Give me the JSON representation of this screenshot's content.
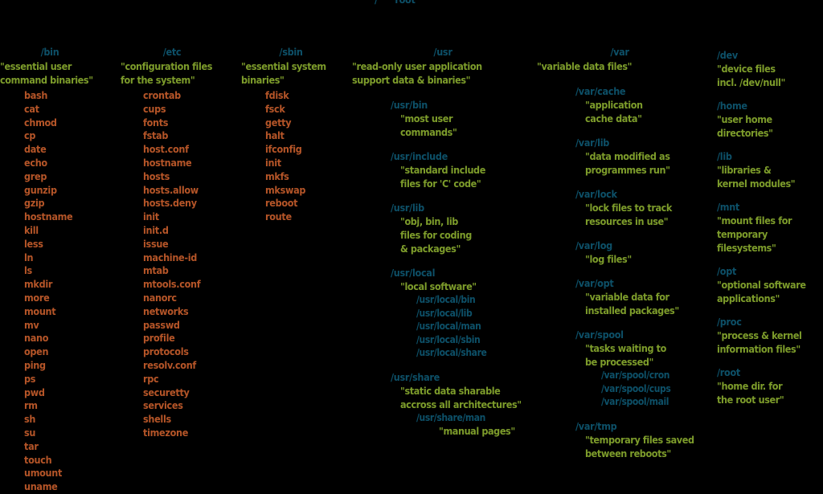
{
  "diagram": {
    "title_root": {
      "path": "/",
      "label": "\"root\""
    },
    "colors": {
      "background": "#000000",
      "directory": "#0d5068",
      "description": "#7d9c2b",
      "file": "#b55528"
    },
    "columns": [
      {
        "id": "bin",
        "name": "/bin",
        "description": [
          "\"essential user",
          "command binaries\""
        ],
        "files": [
          "bash",
          "cat",
          "chmod",
          "cp",
          "date",
          "echo",
          "grep",
          "gunzip",
          "gzip",
          "hostname",
          "kill",
          "less",
          "ln",
          "ls",
          "mkdir",
          "more",
          "mount",
          "mv",
          "nano",
          "open",
          "ping",
          "ps",
          "pwd",
          "rm",
          "sh",
          "su",
          "tar",
          "touch",
          "umount",
          "uname"
        ]
      },
      {
        "id": "etc",
        "name": "/etc",
        "description": [
          "\"configuration files",
          "for the system\""
        ],
        "files": [
          "crontab",
          "cups",
          "fonts",
          "fstab",
          "host.conf",
          "hostname",
          "hosts",
          "hosts.allow",
          "hosts.deny",
          "init",
          "init.d",
          "issue",
          "machine-id",
          "mtab",
          "mtools.conf",
          "nanorc",
          "networks",
          "passwd",
          "profile",
          "protocols",
          "resolv.conf",
          "rpc",
          "securetty",
          "services",
          "shells",
          "timezone"
        ]
      },
      {
        "id": "sbin",
        "name": "/sbin",
        "description": [
          "\"essential system",
          "binaries\""
        ],
        "files": [
          "fdisk",
          "fsck",
          "getty",
          "halt",
          "ifconfig",
          "init",
          "mkfs",
          "mkswap",
          "reboot",
          "route"
        ]
      },
      {
        "id": "usr",
        "name": "/usr",
        "description": [
          "\"read-only user application",
          "support data & binaries\""
        ],
        "groups": [
          {
            "name": "/usr/bin",
            "description": [
              "\"most user",
              "commands\""
            ],
            "children": []
          },
          {
            "name": "/usr/include",
            "description": [
              "\"standard include",
              "files for 'C' code\""
            ],
            "children": []
          },
          {
            "name": "/usr/lib",
            "description": [
              "\"obj, bin, lib",
              "files for coding",
              "& packages\""
            ],
            "children": []
          },
          {
            "name": "/usr/local",
            "description": [
              "\"local software\""
            ],
            "children": [
              "/usr/local/bin",
              "/usr/local/lib",
              "/usr/local/man",
              "/usr/local/sbin",
              "/usr/local/share"
            ]
          },
          {
            "name": "/usr/share",
            "description": [
              "\"static data sharable",
              "accross all architectures\""
            ],
            "children": [
              "/usr/share/man"
            ],
            "child_description": [
              "\"manual pages\""
            ]
          }
        ]
      },
      {
        "id": "var",
        "name": "/var",
        "description": [
          "\"variable data files\""
        ],
        "groups": [
          {
            "name": "/var/cache",
            "description": [
              "\"application",
              "cache data\""
            ],
            "children": []
          },
          {
            "name": "/var/lib",
            "description": [
              "\"data modified as",
              "programmes run\""
            ],
            "children": []
          },
          {
            "name": "/var/lock",
            "description": [
              "\"lock files to track",
              "resources in use\""
            ],
            "children": []
          },
          {
            "name": "/var/log",
            "description": [
              "\"log files\""
            ],
            "children": []
          },
          {
            "name": "/var/opt",
            "description": [
              "\"variable data for",
              "installed packages\""
            ],
            "children": []
          },
          {
            "name": "/var/spool",
            "description": [
              "\"tasks waiting to",
              "be processed\""
            ],
            "children": [
              "/var/spool/cron",
              "/var/spool/cups",
              "/var/spool/mail"
            ]
          },
          {
            "name": "/var/tmp",
            "description": [
              "\"temporary files saved",
              "between reboots\""
            ],
            "children": []
          }
        ]
      },
      {
        "id": "misc",
        "name": "",
        "description": [],
        "groups": [
          {
            "name": "/dev",
            "description": [
              "\"device files",
              "incl. /dev/null\""
            ],
            "children": []
          },
          {
            "name": "/home",
            "description": [
              "\"user home",
              "directories\""
            ],
            "children": []
          },
          {
            "name": "/lib",
            "description": [
              "\"libraries &",
              "kernel modules\""
            ],
            "children": []
          },
          {
            "name": "/mnt",
            "description": [
              "\"mount files for",
              "temporary",
              "filesystems\""
            ],
            "children": []
          },
          {
            "name": "/opt",
            "description": [
              "\"optional software",
              "applications\""
            ],
            "children": []
          },
          {
            "name": "/proc",
            "description": [
              "\"process & kernel",
              "information files\""
            ],
            "children": []
          },
          {
            "name": "/root",
            "description": [
              "\"home dir. for",
              "the root user\""
            ],
            "children": []
          }
        ]
      }
    ]
  }
}
